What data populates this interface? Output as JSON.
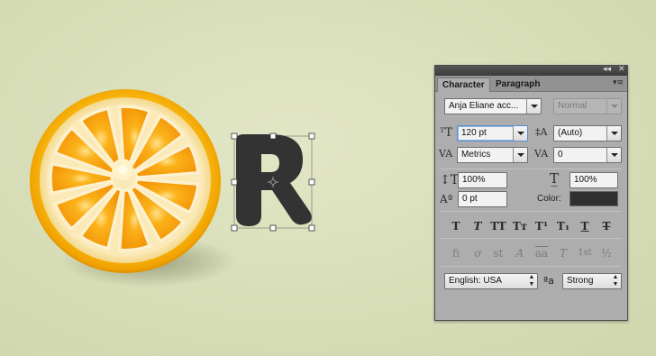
{
  "panel": {
    "tabs": [
      {
        "label": "Character",
        "active": true
      },
      {
        "label": "Paragraph",
        "active": false
      }
    ],
    "collapse_glyph": "◂◂",
    "close_glyph": "✕",
    "menu_glyph": "▾≡",
    "font_family": "Anja Eliane acc...",
    "font_style": "Normal",
    "font_size": "120 pt",
    "leading": "(Auto)",
    "kerning": "Metrics",
    "tracking": "0",
    "vertical_scale": "100%",
    "horizontal_scale": "100%",
    "baseline_shift": "0 pt",
    "color_label": "Color:",
    "text_color": "#2f2f2f",
    "style_buttons": [
      {
        "label": "T",
        "name": "faux-bold-button"
      },
      {
        "label": "T",
        "name": "faux-italic-button"
      },
      {
        "label": "TT",
        "name": "all-caps-button"
      },
      {
        "label": "Tт",
        "name": "small-caps-button"
      },
      {
        "label": "T¹",
        "name": "superscript-button"
      },
      {
        "label": "T₁",
        "name": "subscript-button"
      },
      {
        "label": "T",
        "name": "underline-button"
      },
      {
        "label": "T",
        "name": "strikethrough-button"
      }
    ],
    "opentype_buttons": [
      {
        "label": "fi",
        "name": "standard-ligatures-button"
      },
      {
        "label": "ơ",
        "name": "contextual-alternates-button"
      },
      {
        "label": "st",
        "name": "discretionary-ligatures-button"
      },
      {
        "label": "A",
        "name": "swash-button"
      },
      {
        "label": "aa",
        "name": "stylistic-alternates-button"
      },
      {
        "label": "T",
        "name": "titling-alternates-button"
      },
      {
        "label": "1st",
        "name": "ordinals-button"
      },
      {
        "label": "½",
        "name": "fractions-button"
      }
    ],
    "language": "English: USA",
    "aa_glyph": "ªa",
    "antialias": "Strong"
  },
  "canvas": {
    "letter": "R",
    "letter_color": "#333333",
    "accent_orange": "#f5a51a"
  }
}
